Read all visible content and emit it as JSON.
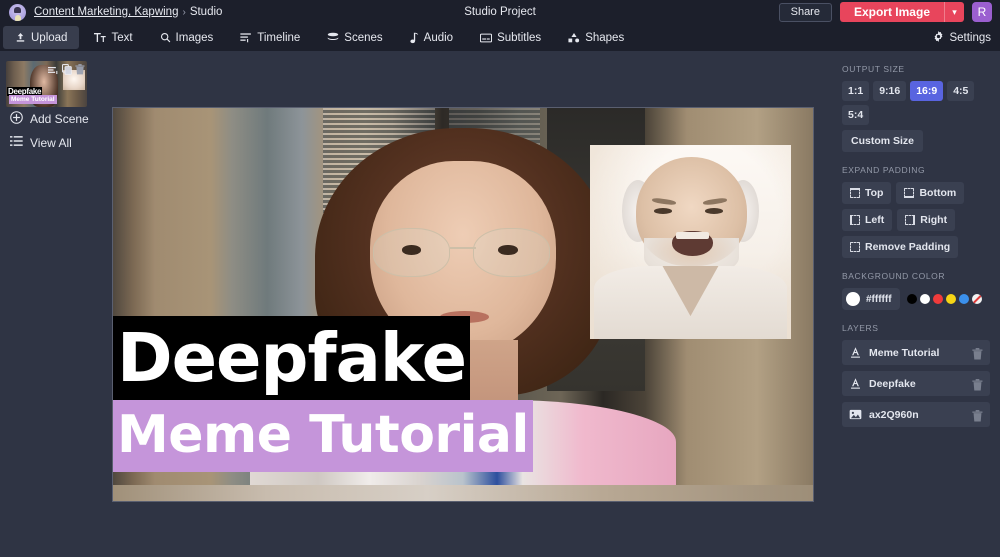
{
  "header": {
    "avatar_icon": "user-avatar-icon",
    "breadcrumb_link": "Content Marketing, Kapwing",
    "breadcrumb_separator": "›",
    "breadcrumb_current": "Studio",
    "project_title": "Studio Project",
    "share_label": "Share",
    "export_label": "Export Image",
    "export_caret_icon": "chevron-down-icon",
    "user_initial": "R",
    "export_color": "#e8455c",
    "avatar_color": "#9b5fd0"
  },
  "toolbar": {
    "items": [
      {
        "label": "Upload",
        "icon": "upload-icon",
        "active": true
      },
      {
        "label": "Text",
        "icon": "text-icon",
        "active": false
      },
      {
        "label": "Images",
        "icon": "search-icon",
        "active": false
      },
      {
        "label": "Timeline",
        "icon": "timeline-icon",
        "active": false
      },
      {
        "label": "Scenes",
        "icon": "scenes-icon",
        "active": false
      },
      {
        "label": "Audio",
        "icon": "audio-note-icon",
        "active": false
      },
      {
        "label": "Subtitles",
        "icon": "subtitles-icon",
        "active": false
      },
      {
        "label": "Shapes",
        "icon": "shapes-icon",
        "active": false
      }
    ],
    "settings_label": "Settings",
    "settings_icon": "gear-icon"
  },
  "left_panel": {
    "scene_thumb": {
      "title_line1": "Deepfake",
      "title_line2": "Meme Tutorial",
      "icons": [
        "captions-icon",
        "duplicate-icon",
        "trash-icon"
      ]
    },
    "add_scene_label": "Add Scene",
    "add_scene_icon": "plus-circle-icon",
    "view_all_label": "View All",
    "view_all_icon": "list-icon"
  },
  "canvas": {
    "text_layers": [
      {
        "text": "Deepfake",
        "background": "#000000",
        "color": "#ffffff"
      },
      {
        "text": "Meme Tutorial",
        "background": "#c595da",
        "color": "#ffffff"
      }
    ],
    "image_layer_name": "ax2Q960n"
  },
  "right_panel": {
    "output_size": {
      "label": "Output Size",
      "options": [
        "1:1",
        "9:16",
        "16:9",
        "4:5",
        "5:4"
      ],
      "selected": "16:9",
      "selected_color": "#5964e0",
      "custom_label": "Custom Size"
    },
    "expand_padding": {
      "label": "Expand Padding",
      "buttons": [
        "Top",
        "Bottom",
        "Left",
        "Right",
        "Remove Padding"
      ]
    },
    "background_color": {
      "label": "Background Color",
      "current_hex": "#ffffff",
      "swatches": [
        "#000000",
        "#ffffff",
        "#f03b3b",
        "#f5d516",
        "#3b90ec",
        "transparent"
      ]
    },
    "layers": {
      "label": "Layers",
      "items": [
        {
          "name": "Meme Tutorial",
          "type": "text-layer-icon"
        },
        {
          "name": "Deepfake",
          "type": "text-layer-icon"
        },
        {
          "name": "ax2Q960n",
          "type": "image-layer-icon"
        }
      ],
      "delete_icon": "trash-icon"
    }
  }
}
